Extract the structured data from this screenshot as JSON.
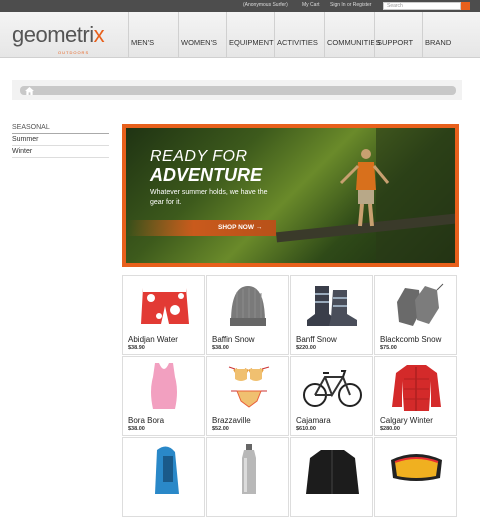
{
  "topbar": {
    "user": "(Anonymous Surfer)",
    "cart": "My Cart",
    "signin": "Sign In or Register",
    "search_placeholder": "Search"
  },
  "logo": {
    "main_a": "geometri",
    "main_x": "x",
    "sub": "OUTDOORS"
  },
  "nav": [
    "MEN'S",
    "WOMEN'S",
    "EQUIPMENT",
    "ACTIVITIES",
    "COMMUNITIES",
    "SUPPORT",
    "BRAND"
  ],
  "sidebar": {
    "heading": "SEASONAL",
    "items": [
      "Summer",
      "Winter"
    ]
  },
  "banner": {
    "line1": "READY FOR",
    "line2": "ADVENTURE",
    "line3": "Whatever summer holds, we have the gear for it.",
    "cta": "SHOP NOW →"
  },
  "products": [
    {
      "name": "Abidjan Water",
      "price": "$38.90",
      "icon": "board-shorts-icon"
    },
    {
      "name": "Baffin Snow",
      "price": "$38.00",
      "icon": "beanie-icon"
    },
    {
      "name": "Banff Snow",
      "price": "$220.00",
      "icon": "ski-boots-icon"
    },
    {
      "name": "Blackcomb Snow",
      "price": "$75.00",
      "icon": "gloves-icon"
    },
    {
      "name": "Bora Bora",
      "price": "$38.00",
      "icon": "tank-top-icon"
    },
    {
      "name": "Brazzaville",
      "price": "$52.00",
      "icon": "bikini-icon"
    },
    {
      "name": "Cajamara",
      "price": "$610.00",
      "icon": "bicycle-icon"
    },
    {
      "name": "Calgary Winter",
      "price": "$280.00",
      "icon": "jacket-icon"
    },
    {
      "name": "",
      "price": "",
      "icon": "backpack-icon"
    },
    {
      "name": "",
      "price": "",
      "icon": "bottle-icon"
    },
    {
      "name": "",
      "price": "",
      "icon": "coat-icon"
    },
    {
      "name": "",
      "price": "",
      "icon": "goggles-icon"
    }
  ],
  "colors": {
    "accent": "#e8601c",
    "topbar": "#4d4d4d"
  }
}
